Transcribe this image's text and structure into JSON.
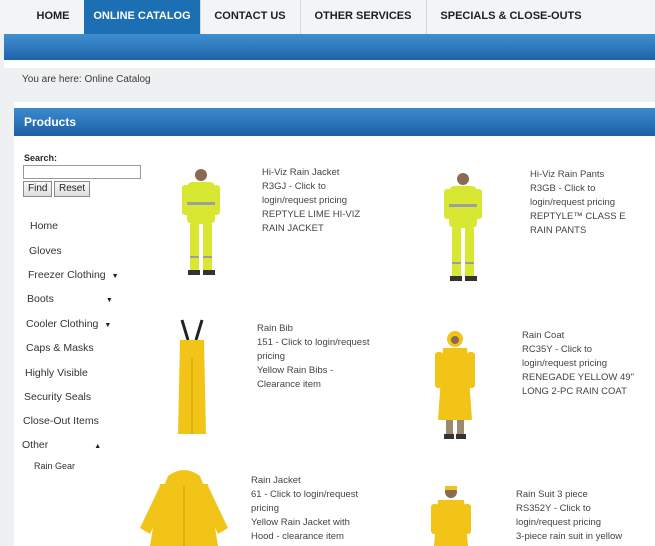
{
  "nav": {
    "items": [
      {
        "label": "HOME"
      },
      {
        "label": "ONLINE CATALOG"
      },
      {
        "label": "CONTACT US"
      },
      {
        "label": "OTHER SERVICES"
      },
      {
        "label": "SPECIALS & CLOSE-OUTS"
      }
    ],
    "active": "ONLINE CATALOG"
  },
  "breadcrumb": {
    "prefix": "You are here:",
    "current": "Online Catalog"
  },
  "panel": {
    "title": "Products"
  },
  "search": {
    "label": "Search:",
    "value": "",
    "find_label": "Find",
    "reset_label": "Reset"
  },
  "sidebar": {
    "items": [
      {
        "label": "Home"
      },
      {
        "label": "Gloves"
      },
      {
        "label": "Freezer Clothing",
        "caret": "▼"
      },
      {
        "label": "Boots",
        "caret": "▼"
      },
      {
        "label": "Cooler Clothing",
        "caret": "▼"
      },
      {
        "label": "Caps & Masks"
      },
      {
        "label": "Highly Visible"
      },
      {
        "label": "Security Seals"
      },
      {
        "label": "Close-Out Items"
      },
      {
        "label": "Other",
        "caret": "▲"
      }
    ],
    "subitems": [
      {
        "label": "Rain Gear"
      }
    ]
  },
  "products": [
    {
      "name": "Hi-Viz Rain Jacket",
      "sku_line": "R3GJ - Click to",
      "pricing": "login/request pricing",
      "desc1": "REPTYLE LIME HI-VIZ",
      "desc2": "RAIN JACKET",
      "image": "person-hi-viz-jacket"
    },
    {
      "name": "Hi-Viz Rain Pants",
      "sku_line": "R3GB - Click to",
      "pricing": "login/request pricing",
      "desc1": "REPTYLE™ CLASS E",
      "desc2": "RAIN PANTS",
      "image": "person-hi-viz-pants"
    },
    {
      "name": "Rain Bib",
      "sku_line": "151 - Click to login/request",
      "pricing": "pricing",
      "desc1": "Yellow Rain Bibs -",
      "desc2": "Clearance item",
      "image": "yellow-rain-bib"
    },
    {
      "name": "Rain Coat",
      "sku_line": "RC35Y - Click to",
      "pricing": "login/request pricing",
      "desc1": "RENEGADE YELLOW 49\"",
      "desc2": "LONG 2-PC RAIN COAT",
      "image": "person-yellow-rain-coat"
    },
    {
      "name": "Rain Jacket",
      "sku_line": "61 - Click to login/request",
      "pricing": "pricing",
      "desc1": "Yellow Rain Jacket with",
      "desc2": "Hood - clearance item",
      "image": "yellow-rain-jacket"
    },
    {
      "name": "Rain Suit 3 piece",
      "sku_line": "RS352Y - Click to",
      "pricing": "login/request pricing",
      "desc1": "3-piece rain suit in yellow",
      "desc2": "",
      "image": "person-yellow-rain-suit"
    }
  ],
  "colors": {
    "nav_active": "#1d6fb3",
    "blue_bar": "#2a75bd",
    "hi_viz": "#d8e832",
    "rain_yellow": "#f2c418"
  }
}
